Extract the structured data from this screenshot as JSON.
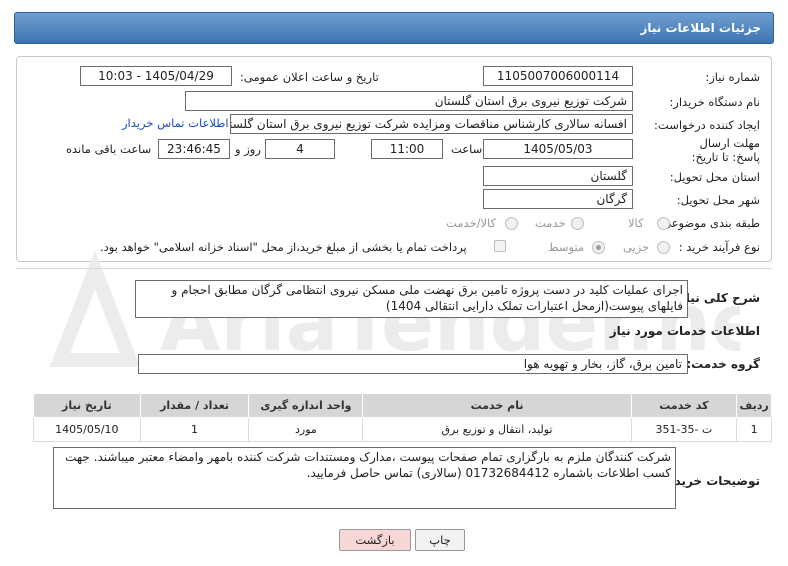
{
  "header": {
    "title": "جزئیات اطلاعات نیاز"
  },
  "fields": {
    "need_number_label": "شماره نیاز:",
    "need_number": "1105007006000114",
    "announce_label": "تاریخ و ساعت اعلان عمومی:",
    "announce_value": "1405/04/29 - 10:03",
    "buyer_org_label": "نام دستگاه خریدار:",
    "buyer_org": "شرکت توزیع نیروی برق استان گلستان",
    "creator_label": "ایجاد کننده درخواست:",
    "creator": "افسانه سالاری کارشناس مناقصات ومزایده شرکت توزیع نیروی برق استان گلستان",
    "contact_link": "اطلاعات تماس خریدار",
    "deadline_label": "مهلت ارسال پاسخ: تا تاریخ:",
    "deadline_date": "1405/05/03",
    "time_label": "ساعت",
    "deadline_time": "11:00",
    "days_value": "4",
    "days_label": "روز و",
    "remaining_value": "23:46:45",
    "remaining_label": "ساعت باقی مانده",
    "province_label": "استان محل تحویل:",
    "province": "گلستان",
    "city_label": "شهر محل تحویل:",
    "city": "گرگان",
    "category_label": "طبقه بندی موضوعی:",
    "category_options": [
      "کالا",
      "خدمت",
      "کالا/خدمت"
    ],
    "process_label": "نوع فرآیند خرید :",
    "process_options": [
      "جزیی",
      "متوسط"
    ],
    "payment_note": "پرداخت تمام یا بخشی از مبلغ خرید،از محل \"اسناد خزانه اسلامی\" خواهد بود."
  },
  "description": {
    "label": "شرح کلی نیاز:",
    "text": "اجرای عملیات کلید در دست پروژه تامین برق نهضت ملی مسکن نیروی انتظامی گرگان مطابق احجام و فایلهای پیوست(ازمحل اعتبارات تملک دارایی انتقالی 1404)"
  },
  "services": {
    "section_title": "اطلاعات خدمات مورد نیاز",
    "group_label": "گروه خدمت:",
    "group_value": "تامین برق، گاز، بخار و تهویه هوا",
    "columns": [
      "ردیف",
      "کد خدمت",
      "نام خدمت",
      "واحد اندازه گیری",
      "تعداد / مقدار",
      "تاریخ نیاز"
    ],
    "rows": [
      [
        "1",
        "ت -35-351",
        "تولید، انتقال و توزیع برق",
        "مورد",
        "1",
        "1405/05/10"
      ]
    ]
  },
  "buyer_notes": {
    "label": "توضیحات خریدار:",
    "text": "شرکت کنندگان ملزم به بارگزاری تمام صفحات پیوست ،مدارک ومستندات شرکت کننده بامهر وامضاء معتبر میباشند. جهت کسب اطلاعات باشماره 01732684412 (سالاری) تماس حاصل فرمایید."
  },
  "buttons": {
    "print": "چاپ",
    "back": "بازگشت"
  },
  "colors": {
    "header": "#3d74b3",
    "back_button": "#f7d6d6",
    "link": "#1a4fb5"
  },
  "watermark": "AriaTender.net"
}
